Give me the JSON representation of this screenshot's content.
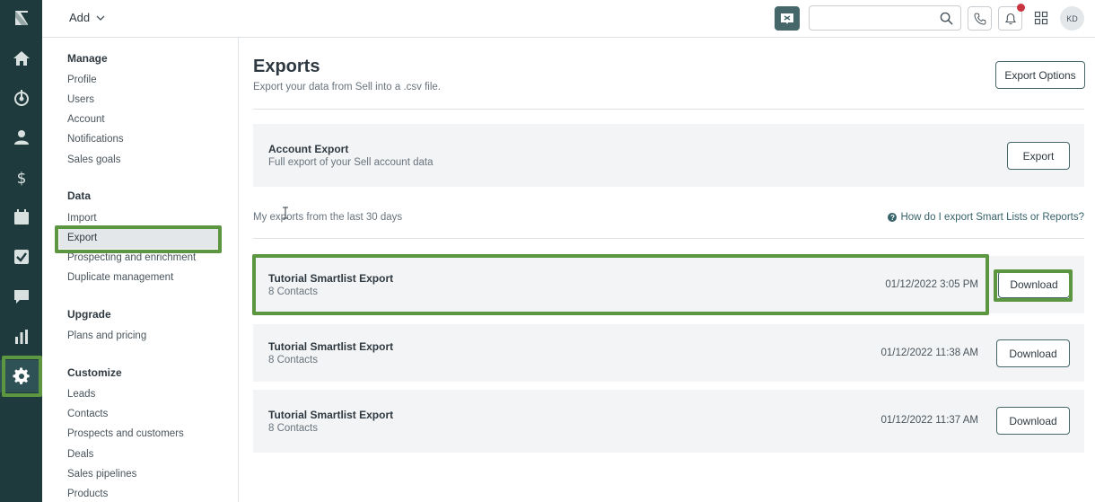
{
  "header": {
    "add_label": "Add",
    "search": {
      "placeholder": "",
      "value": ""
    },
    "avatar_initials": "KD",
    "icons": [
      "chat-icon",
      "search-icon",
      "phone-icon",
      "bell-icon",
      "apps-grid-icon"
    ]
  },
  "rail": {
    "items": [
      "logo",
      "home-icon",
      "leads-icon",
      "contacts-icon",
      "deals-icon",
      "calendar-icon",
      "tasks-icon",
      "messages-icon",
      "reports-icon",
      "settings-icon"
    ],
    "active": "settings-icon"
  },
  "settings_nav": {
    "sections": [
      {
        "heading": "Manage",
        "items": [
          "Profile",
          "Users",
          "Account",
          "Notifications",
          "Sales goals"
        ]
      },
      {
        "heading": "Data",
        "items": [
          "Import",
          "Export",
          "Prospecting and enrichment",
          "Duplicate management"
        ]
      },
      {
        "heading": "Upgrade",
        "items": [
          "Plans and pricing"
        ]
      },
      {
        "heading": "Customize",
        "items": [
          "Leads",
          "Contacts",
          "Prospects and customers",
          "Deals",
          "Sales pipelines",
          "Products"
        ]
      }
    ],
    "selected": "Export"
  },
  "main": {
    "title": "Exports",
    "subtitle": "Export your data from Sell into a .csv file.",
    "export_options_label": "Export Options",
    "account_export": {
      "title": "Account Export",
      "description": "Full export of your Sell account data",
      "button_label": "Export"
    },
    "recent_label": "My exports from the last 30 days",
    "help_link": "How do I export Smart Lists or Reports?",
    "exports": [
      {
        "title": "Tutorial Smartlist Export",
        "count": "8 Contacts",
        "date": "01/12/2022 3:05 PM",
        "button_label": "Download"
      },
      {
        "title": "Tutorial Smartlist Export",
        "count": "8 Contacts",
        "date": "01/12/2022 11:38 AM",
        "button_label": "Download"
      },
      {
        "title": "Tutorial Smartlist Export",
        "count": "8 Contacts",
        "date": "01/12/2022 11:37 AM",
        "button_label": "Download"
      }
    ]
  },
  "colors": {
    "rail_bg": "#1f3a3d",
    "highlight": "#5c9640",
    "accent": "#46676a",
    "notification": "#cc3340"
  }
}
